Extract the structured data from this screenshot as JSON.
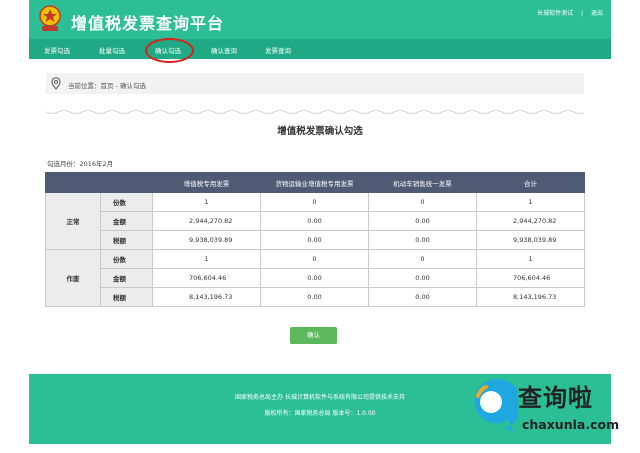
{
  "header": {
    "title": "增值税发票查询平台",
    "user_name": "长城软件测试",
    "logout": "退出"
  },
  "nav": [
    {
      "label": "发票勾选"
    },
    {
      "label": "批量勾选"
    },
    {
      "label": "确认勾选"
    },
    {
      "label": "确认查询"
    },
    {
      "label": "发票查询"
    }
  ],
  "breadcrumb": "当前位置：首页 - 确认勾选",
  "page_title": "增值税发票确认勾选",
  "period": "勾选月份：2016年2月",
  "table": {
    "headers": [
      "",
      "",
      "增值税专用发票",
      "货物运输业增值税专用发票",
      "机动车销售统一发票",
      "合计"
    ],
    "groups": [
      {
        "name": "正常",
        "rows": [
          {
            "label": "份数",
            "values": [
              "1",
              "0",
              "0",
              "1"
            ]
          },
          {
            "label": "金额",
            "values": [
              "2,944,270.82",
              "0.00",
              "0.00",
              "2,944,270.82"
            ]
          },
          {
            "label": "税额",
            "values": [
              "9,938,039.89",
              "0.00",
              "0.00",
              "9,938,039.89"
            ]
          }
        ]
      },
      {
        "name": "作废",
        "rows": [
          {
            "label": "份数",
            "values": [
              "1",
              "0",
              "0",
              "1"
            ]
          },
          {
            "label": "金额",
            "values": [
              "706,604.46",
              "0.00",
              "0.00",
              "706,604.46"
            ]
          },
          {
            "label": "税额",
            "values": [
              "8,143,196.73",
              "0.00",
              "0.00",
              "8,143,196.73"
            ]
          }
        ]
      }
    ]
  },
  "confirm_button": "确认",
  "footer": {
    "line1": "国家税务总局主办 长城计算机软件与系统有限公司提供技术支持",
    "line2": "版权所有：国家税务总局 版本号：1.0.00"
  },
  "watermark": {
    "brand": "查询啦",
    "domain": "chaxunla.com"
  },
  "colors": {
    "header_green": "#2cbf96",
    "nav_green": "#1fa985",
    "table_header": "#4f5a74",
    "button_green": "#5cb85c",
    "highlight_circle": "#d9201c"
  }
}
